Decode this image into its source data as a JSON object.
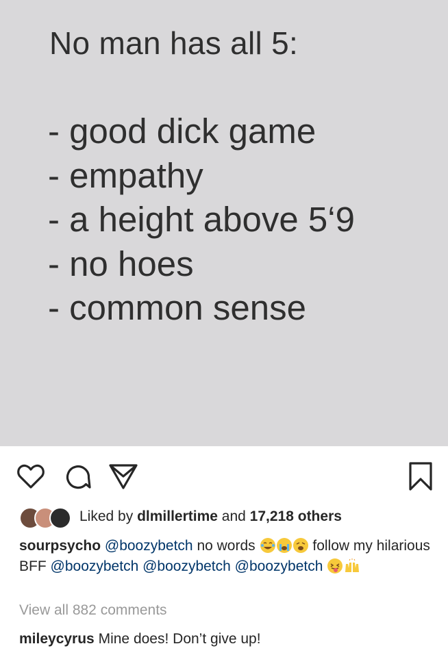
{
  "post_image": {
    "heading": "No man has all 5:",
    "items": [
      "- good dick game",
      "- empathy",
      "- a height above 5‘9",
      "- no hoes",
      "- common sense"
    ]
  },
  "actions": {
    "like_icon": "heart-icon",
    "comment_icon": "comment-icon",
    "share_icon": "paper-plane-icon",
    "save_icon": "bookmark-icon"
  },
  "likes": {
    "prefix": "Liked by",
    "user": "dlmillertime",
    "and": "and",
    "count": "17,218 others"
  },
  "caption": {
    "username": "sourpsycho",
    "mention1": "@boozybetch",
    "text1": "no words",
    "text2": "follow my hilarious BFF",
    "mention2": "@boozybetch",
    "mention3": "@boozybetch",
    "mention4": "@boozybetch",
    "emojis": [
      "laughing-tears-emoji",
      "crying-emoji",
      "weary-emoji",
      "tongue-out-emoji",
      "raised-hands-emoji"
    ]
  },
  "view_all_comments": "View all 882 comments",
  "comment": {
    "username": "mileycyrus",
    "text": "Mine does! Don’t give up!"
  },
  "colors": {
    "image_bg": "#d9d8da",
    "link": "#003569",
    "muted": "#999999"
  }
}
